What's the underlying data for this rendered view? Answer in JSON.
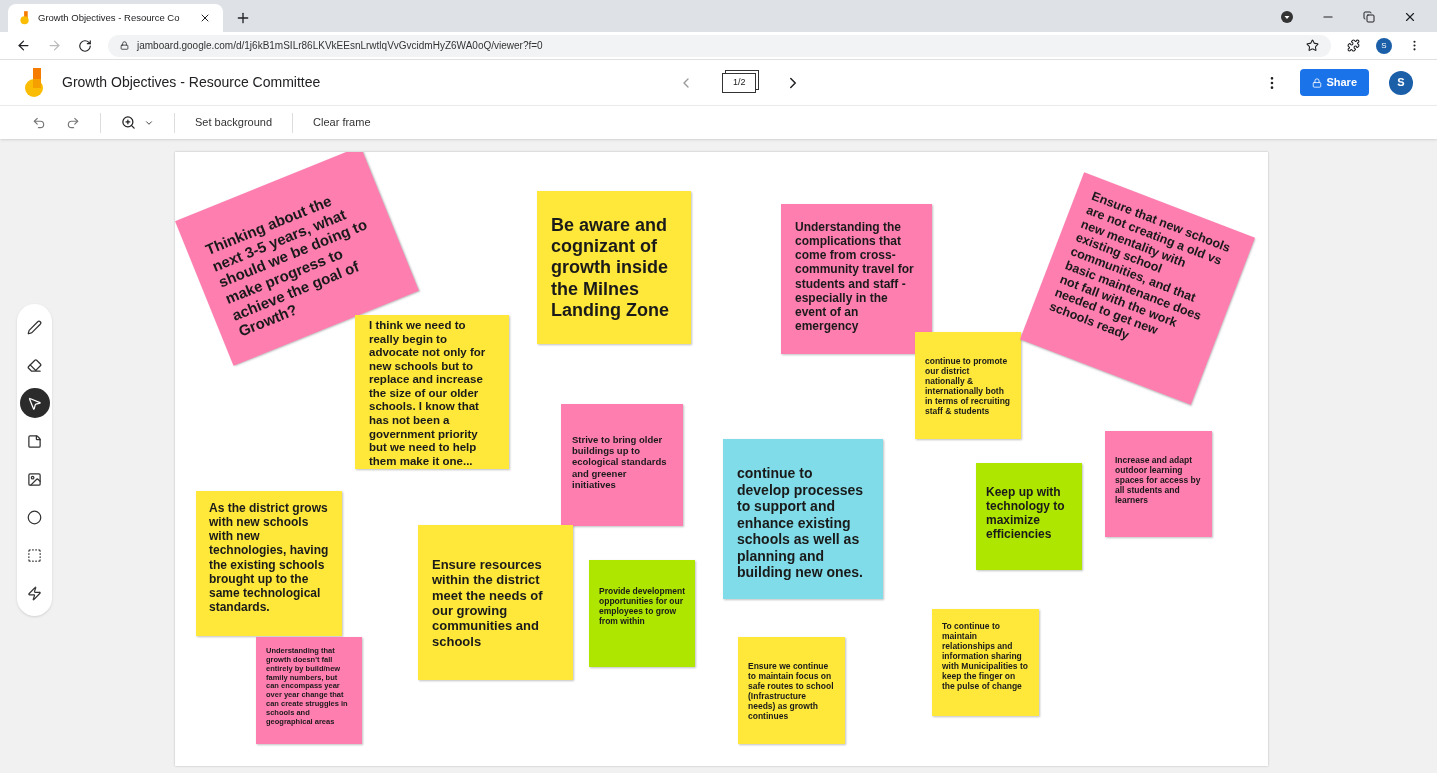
{
  "browser": {
    "tab_title": "Growth Objectives - Resource Co",
    "url": "jamboard.google.com/d/1j6kB1mSILr86LKVkEEsnLrwtlqVvGvcidmHyZ6WA0oQ/viewer?f=0",
    "profile_initial": "S"
  },
  "app": {
    "title": "Growth Objectives - Resource Committee",
    "frame_indicator": "1/2",
    "share_label": "Share",
    "avatar_initial": "S"
  },
  "toolbar": {
    "buttons": [
      "Set background",
      "Clear frame"
    ]
  },
  "tools": [
    {
      "kind": "pen",
      "selected": false
    },
    {
      "kind": "eraser",
      "selected": false
    },
    {
      "kind": "select",
      "selected": true
    },
    {
      "kind": "sticky",
      "selected": false
    },
    {
      "kind": "image",
      "selected": false
    },
    {
      "kind": "circle",
      "selected": false
    },
    {
      "kind": "textbox",
      "selected": false
    },
    {
      "kind": "laser",
      "selected": false
    }
  ],
  "notes": [
    {
      "text": "Thinking about the next 3-5 years, what should we be doing to make progress to achieve the goal of Growth?",
      "color": "#ff7eb0"
    },
    {
      "text": "I think we need to really begin to advocate not only for new schools but to replace and increase the size of our older schools. I know that has not been a government priority but we need to help them make it one...",
      "color": "#ffe83a"
    },
    {
      "text": "Be aware and cognizant of growth inside the Milnes Landing Zone",
      "color": "#ffe83a"
    },
    {
      "text": "Understanding the complications that come from cross-community travel for students and staff - especially in the event of an emergency",
      "color": "#ff7eb0"
    },
    {
      "text": "continue to promote our district nationally & internationally both in terms of recruiting staff & students",
      "color": "#ffe83a"
    },
    {
      "text": "Ensure that new schools are not creating a old vs new mentality with existing school communities, and that basic maintenance does not fall with the work needed to get new schools ready",
      "color": "#ff7eb0"
    },
    {
      "text": "Strive to bring older buildings up to ecological standards and greener initiatives",
      "color": "#ff7eb0"
    },
    {
      "text": "continue to develop processes to support and enhance existing schools as well as planning and building new ones.",
      "color": "#7fdce8"
    },
    {
      "text": "Keep up with technology to maximize efficiencies",
      "color": "#aee600"
    },
    {
      "text": "Increase and adapt outdoor learning spaces for access by all students and learners",
      "color": "#ff7eb0"
    },
    {
      "text": "As the district grows with new schools with new technologies, having the existing schools brought up to the same technological standards.",
      "color": "#ffe83a"
    },
    {
      "text": "Ensure resources within the district meet the needs of our growing communities and schools",
      "color": "#ffe83a"
    },
    {
      "text": "Provide development opportunities for our employees to grow from within",
      "color": "#aee600"
    },
    {
      "text": "Understanding that growth doesn't fall entirely by build/new family numbers, but can encompass year over year change that can create struggles in schools and geographical areas",
      "color": "#ff7eb0"
    },
    {
      "text": "Ensure we continue to maintain focus on safe routes to school (Infrastructure needs)  as growth continues",
      "color": "#ffe83a"
    },
    {
      "text": "To continue to maintain relationships and information sharing with Municipalities to keep the finger on the pulse of change",
      "color": "#ffe83a"
    }
  ]
}
